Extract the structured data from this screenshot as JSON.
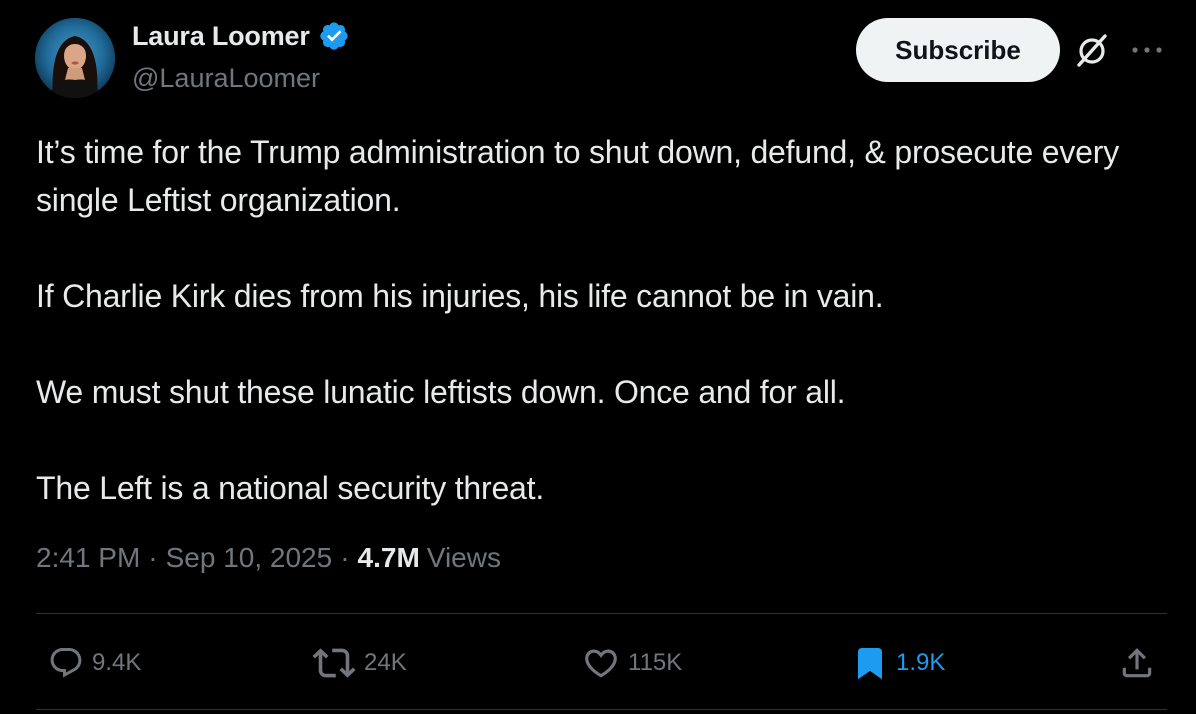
{
  "author": {
    "display_name": "Laura Loomer",
    "handle": "@LauraLoomer",
    "verified": true,
    "verified_color": "#1d9bf0"
  },
  "header": {
    "subscribe_label": "Subscribe",
    "grok_icon": "grok-icon",
    "more_icon": "more-icon"
  },
  "tweet": {
    "paragraphs": [
      "It’s time for the Trump administration to shut down, defund, & prosecute every single Leftist organization.",
      "If Charlie Kirk dies from his injuries, his life cannot be in vain.",
      "We must shut these lunatic leftists down. Once and for all.",
      "The Left is a national security threat."
    ]
  },
  "meta": {
    "time": "2:41 PM",
    "separator": "·",
    "date": "Sep 10, 2025",
    "views_count": "4.7M",
    "views_label": "Views"
  },
  "actions": {
    "replies": "9.4K",
    "reposts": "24K",
    "likes": "115K",
    "bookmarks": "1.9K",
    "bookmark_active_color": "#1d9bf0"
  },
  "colors": {
    "background": "#000000",
    "text_primary": "#e7e9ea",
    "text_secondary": "#71767b",
    "divider": "#2f3336",
    "accent": "#1d9bf0"
  }
}
